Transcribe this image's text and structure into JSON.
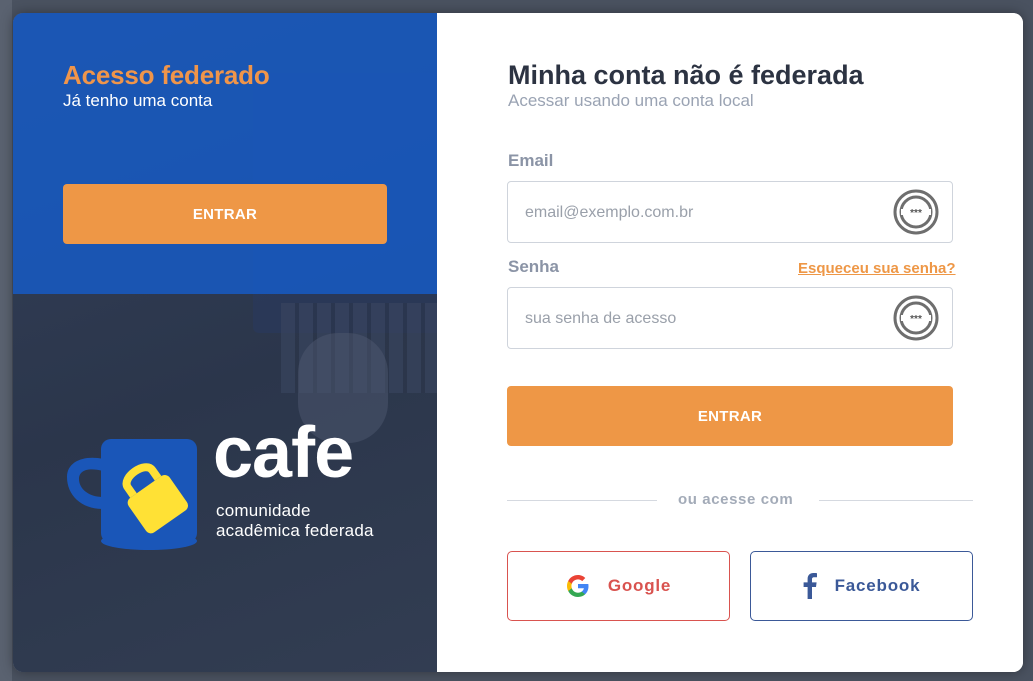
{
  "federated": {
    "title": "Acesso federado",
    "subtitle": "Já tenho uma conta",
    "button_label": "ENTRAR"
  },
  "logo": {
    "word": "cafe",
    "line1": "comunidade",
    "line2": "acadêmica federada"
  },
  "local": {
    "title": "Minha conta não é federada",
    "subtitle": "Acessar usando uma conta local",
    "email_label": "Email",
    "email_placeholder": "email@exemplo.com.br",
    "password_label": "Senha",
    "password_placeholder": "sua senha de acesso",
    "forgot_link": "Esqueceu sua senha?",
    "button_label": "ENTRAR",
    "divider_text": "ou acesse com",
    "google_label": "Google",
    "facebook_label": "Facebook"
  },
  "icons": {
    "password_manager": "password-manager-icon",
    "google": "google-icon",
    "facebook": "facebook-icon",
    "cup": "coffee-cup-icon"
  },
  "colors": {
    "accent": "#ee9746",
    "federated_panel": "#165cc8",
    "google": "#d9534f",
    "facebook": "#3b5998"
  }
}
